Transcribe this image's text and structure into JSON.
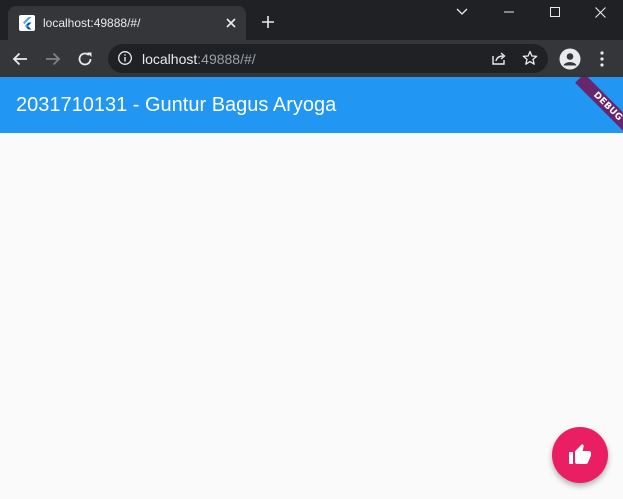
{
  "browser": {
    "tab": {
      "title": "localhost:49888/#/",
      "favicon": "flutter-icon"
    },
    "address_bar": {
      "host": "localhost",
      "path": ":49888/#/"
    }
  },
  "app": {
    "appbar_title": "2031710131 - Guntur Bagus Aryoga",
    "debug_banner": "DEBUG",
    "fab_icon": "thumb-up-icon"
  },
  "colors": {
    "appbar": "#2196f3",
    "fab": "#e91e63",
    "background": "#fafafa",
    "browser_dark": "#202124",
    "browser_toolbar": "#35363a"
  }
}
